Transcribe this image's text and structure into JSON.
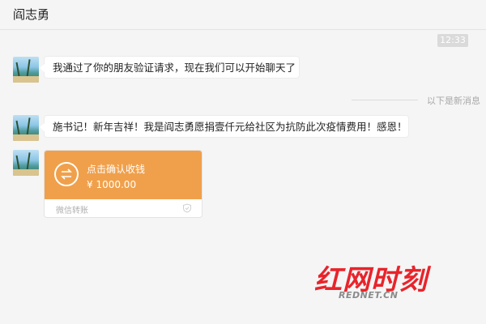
{
  "header": {
    "title": "阎志勇"
  },
  "chat": {
    "time_chip": "12:33",
    "divider_label": "以下是新消息",
    "messages": [
      {
        "text": "我通过了你的朋友验证请求，现在我们可以开始聊天了"
      },
      {
        "text": "施书记！新年吉祥！我是阎志勇愿捐壹仟元给社区为抗防此次疫情费用！感恩！"
      }
    ],
    "transfer": {
      "action": "点击确认收钱",
      "amount": "¥ 1000.00",
      "source": "微信转账",
      "color": "#f0a04b"
    }
  },
  "watermark": {
    "text": "红网时刻",
    "sub": "REDNET.CN",
    "color": "#e8242b"
  }
}
